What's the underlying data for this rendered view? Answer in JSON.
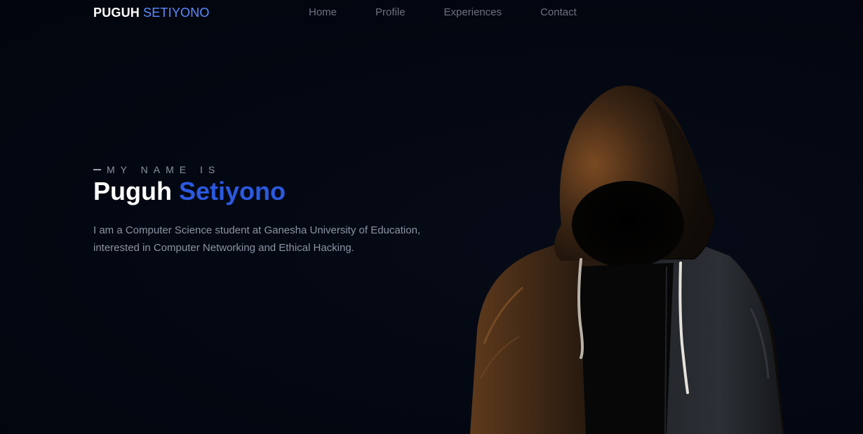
{
  "brand": {
    "first": "PUGUH",
    "last": "SETIYONO"
  },
  "nav": {
    "items": [
      {
        "label": "Home"
      },
      {
        "label": "Profile"
      },
      {
        "label": "Experiences"
      },
      {
        "label": "Contact"
      }
    ]
  },
  "hero": {
    "eyebrow": "MY NAME IS",
    "name_first": "Puguh",
    "name_last": "Setiyono",
    "description": "I am a Computer Science student at Ganesha University of Education, interested in Computer Networking and Ethical Hacking."
  },
  "colors": {
    "background": "#030711",
    "accent": "#2b59e0",
    "brand_accent": "#5b8cff",
    "muted_text": "#8b93a3"
  }
}
